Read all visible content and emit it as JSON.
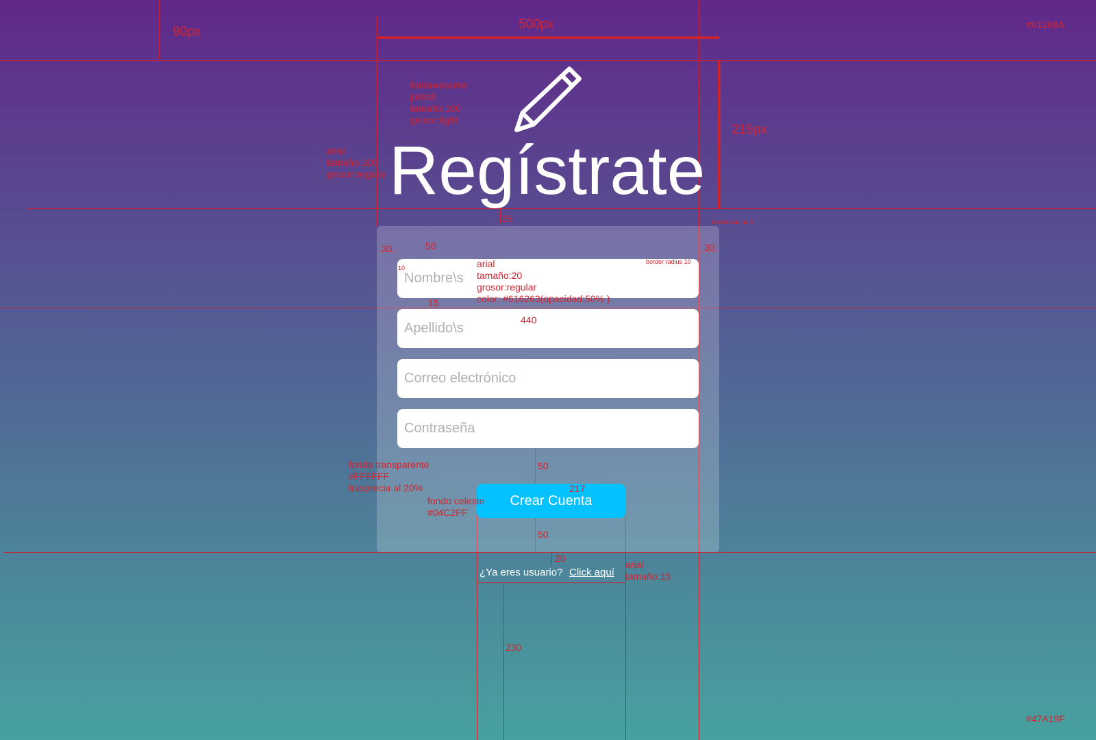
{
  "colors": {
    "background_top": "#61288A",
    "background_bottom": "#47A19F",
    "button_background": "#04C2FF",
    "annotation": "#d4232d"
  },
  "header": {
    "icon": "pencil-icon",
    "title": "Regístrate"
  },
  "form": {
    "fields": [
      {
        "placeholder": "Nombre\\s"
      },
      {
        "placeholder": "Apellido\\s"
      },
      {
        "placeholder": "Correo electrónico"
      },
      {
        "placeholder": "Contraseña"
      }
    ],
    "submit_label": "Crear Cuenta"
  },
  "footer": {
    "question": "¿Ya eres usuario?",
    "link_label": "Click aquí"
  },
  "annotations": {
    "color_top": "#61288A",
    "color_bottom": "#47A19F",
    "width_500": "500px",
    "height_215": "215px",
    "left_90": "90px",
    "icon_spec": [
      "fontawesome",
      "pencil",
      "tamaño:100",
      "grosor:light"
    ],
    "title_spec": [
      "arial",
      "tamaño:100",
      "grosor:regular"
    ],
    "gap_25": "25",
    "border_radius_card": "border radius 6",
    "pad_30_left": "30",
    "pad_30_right": "30",
    "top_50": "50",
    "pad_10": "10",
    "border_radius_field": "border radius 10",
    "field_spec": [
      "arial",
      "tamaño:20",
      "grosor:regular",
      "color: #616263(opacidad:50% )"
    ],
    "gap_15": "15",
    "width_440": "440",
    "gap_50_a": "50",
    "card_bg_spec": [
      "fondo transparente",
      "#FFFFFF",
      "trasprecia al 20%"
    ],
    "width_217": "217",
    "button_bg_spec": [
      "fondo celeste",
      "#04C2FF"
    ],
    "gap_50_b": "50",
    "gap_20": "20",
    "footer_spec": [
      "arial",
      "tamaño:15"
    ],
    "gap_230": "230"
  }
}
